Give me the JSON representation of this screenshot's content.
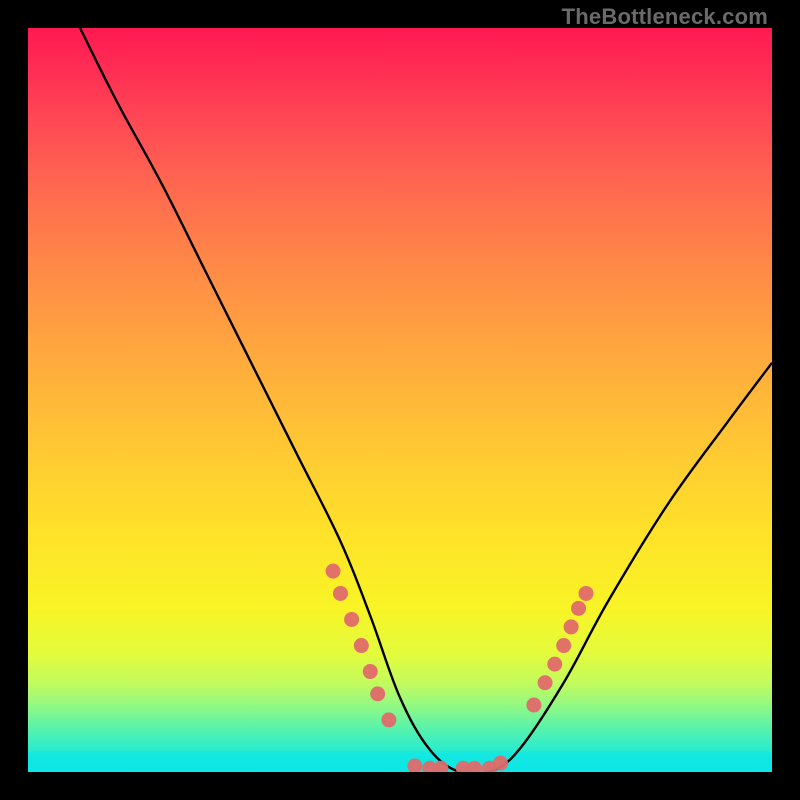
{
  "watermark": {
    "text": "TheBottleneck.com"
  },
  "chart_data": {
    "type": "line",
    "title": "",
    "xlabel": "",
    "ylabel": "",
    "xlim": [
      0,
      100
    ],
    "ylim": [
      0,
      100
    ],
    "grid": false,
    "legend": false,
    "background": "red-yellow-green vertical gradient",
    "series": [
      {
        "name": "bottleneck-curve",
        "color": "#000000",
        "x": [
          7,
          12,
          18,
          24,
          30,
          36,
          42,
          46,
          50,
          54,
          58,
          62,
          66,
          72,
          78,
          86,
          94,
          100
        ],
        "y": [
          100,
          90,
          79,
          67,
          55,
          43,
          31,
          21,
          10,
          3,
          0,
          0,
          3,
          12,
          23,
          36,
          47,
          55
        ]
      }
    ],
    "point_overlays": [
      {
        "name": "left-cluster",
        "color": "#e06a6a",
        "x": [
          41,
          42,
          43.5,
          44.8,
          46,
          47,
          48.5
        ],
        "y": [
          27,
          24,
          20.5,
          17,
          13.5,
          10.5,
          7
        ]
      },
      {
        "name": "bottom-cluster",
        "color": "#e06a6a",
        "x": [
          52,
          54,
          55.5,
          58.5,
          60,
          62,
          63.5
        ],
        "y": [
          0.8,
          0.5,
          0.5,
          0.5,
          0.5,
          0.5,
          1.2
        ]
      },
      {
        "name": "right-cluster",
        "color": "#e06a6a",
        "x": [
          68,
          69.5,
          70.8,
          72,
          73,
          74,
          75
        ],
        "y": [
          9,
          12,
          14.5,
          17,
          19.5,
          22,
          24
        ]
      }
    ],
    "annotations": []
  }
}
